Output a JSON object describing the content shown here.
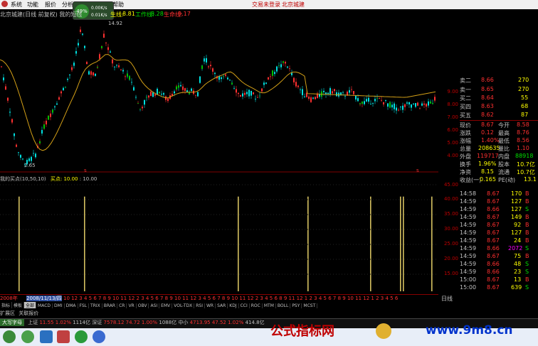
{
  "menu": {
    "items": [
      "系统",
      "功能",
      "报价",
      "分析",
      "帮助"
    ],
    "login_text": "交易未登录",
    "city_text": "北京城建"
  },
  "speed_widget": {
    "percent": "49%",
    "up": "0.00K/s",
    "down": "0.01K/s"
  },
  "chart_header": {
    "title": "北京城建(日线 前复权) 我的短线",
    "ma_prefix": "生线:",
    "ma_value": "8.81",
    "work_label": "工作线:",
    "work_value": "8.28",
    "life_label": "生命线:",
    "life_value": "9.17"
  },
  "price_chart": {
    "high_label": "14.92",
    "low_label": "2.65",
    "axis_labels": [
      "9.00",
      "8.00",
      "7.00",
      "6.00",
      "5.00",
      "4.00"
    ],
    "colors": {
      "up": "#ff3030",
      "down": "#00e0e0",
      "ma": "#d4a017",
      "buy_signal": "#00c000"
    }
  },
  "chart_data": {
    "type": "bar",
    "title": "我的买点(10,50,10)",
    "series": [
      {
        "name": "买点",
        "value_label": "10.00",
        "value2": "10.00"
      }
    ],
    "ylim": [
      0,
      45
    ],
    "y_ticks": [
      "45.00",
      "40.00",
      "35.00",
      "30.00",
      "25.00",
      "20.00",
      "15.00"
    ],
    "signal_values": [
      40,
      40,
      40,
      40,
      40,
      40,
      40,
      40
    ]
  },
  "indicator_header": {
    "name": "我的买点(10,50,10)",
    "label": "买点:",
    "value": "10.00",
    "value2": "10.00"
  },
  "quote": {
    "asks": [
      {
        "label": "卖二",
        "price": "8.66",
        "vol": "270"
      },
      {
        "label": "卖一",
        "price": "8.65",
        "vol": "270"
      },
      {
        "label": "买二",
        "price": "8.64",
        "vol": "55"
      },
      {
        "label": "买四",
        "price": "8.63",
        "vol": "68"
      },
      {
        "label": "买五",
        "price": "8.62",
        "vol": "87"
      }
    ],
    "stats": [
      {
        "l1": "现价",
        "v1": "8.67",
        "l2": "今开",
        "v2": "8.58"
      },
      {
        "l1": "涨跌",
        "v1": "0.12",
        "l2": "最高",
        "v2": "8.76"
      },
      {
        "l1": "涨幅",
        "v1": "1.40%",
        "l2": "最低",
        "v2": "8.56"
      },
      {
        "l1": "总量",
        "v1": "208635",
        "l2": "量比",
        "v2": "1.10"
      },
      {
        "l1": "外盘",
        "v1": "119717",
        "l2": "内盘",
        "v2": "88918"
      },
      {
        "l1": "换手",
        "v1": "1.96%",
        "l2": "股本",
        "v2": "10.7亿"
      },
      {
        "l1": "净资",
        "v1": "8.15",
        "l2": "流通",
        "v2": "10.7亿"
      },
      {
        "l1": "收益(一)",
        "v1": "0.165",
        "l2": "PE(动)",
        "v2": "13.1"
      }
    ]
  },
  "trades": [
    {
      "time": "14:58",
      "price": "8.67",
      "vol": "170",
      "side": "B"
    },
    {
      "time": "14:59",
      "price": "8.67",
      "vol": "127",
      "side": "B"
    },
    {
      "time": "14:59",
      "price": "8.66",
      "vol": "127",
      "side": "S"
    },
    {
      "time": "14:59",
      "price": "8.67",
      "vol": "149",
      "side": "B"
    },
    {
      "time": "14:59",
      "price": "8.67",
      "vol": "92",
      "side": "B"
    },
    {
      "time": "14:59",
      "price": "8.67",
      "vol": "127",
      "side": "B"
    },
    {
      "time": "14:59",
      "price": "8.67",
      "vol": "24",
      "side": "B"
    },
    {
      "time": "14:59",
      "price": "8.66",
      "vol": "2072",
      "side": "S"
    },
    {
      "time": "14:59",
      "price": "8.67",
      "vol": "75",
      "side": "B"
    },
    {
      "time": "14:59",
      "price": "8.66",
      "vol": "48",
      "side": "S"
    },
    {
      "time": "14:59",
      "price": "8.66",
      "vol": "23",
      "side": "S"
    },
    {
      "time": "15:00",
      "price": "8.67",
      "vol": "13",
      "side": "B"
    },
    {
      "time": "15:00",
      "price": "8.67",
      "vol": "639",
      "side": "S"
    }
  ],
  "date_axis": {
    "start": "2008年",
    "highlight": "2008/11/13/四",
    "ticks": [
      "10",
      "12",
      "3",
      "4",
      "5",
      "6",
      "7",
      "8",
      "9",
      "10",
      "11",
      "12",
      "2",
      "3",
      "4",
      "5",
      "6",
      "7",
      "8",
      "9",
      "10",
      "11",
      "12",
      "3",
      "4",
      "5",
      "6",
      "7",
      "8",
      "9",
      "10",
      "11",
      "12",
      "2",
      "3",
      "4",
      "5",
      "6",
      "8",
      "9",
      "11",
      "12",
      "1",
      "2",
      "3",
      "4",
      "5",
      "6",
      "7",
      "8",
      "9",
      "10",
      "11",
      "12",
      "1",
      "2",
      "3",
      "4",
      "5",
      "6"
    ]
  },
  "right_period": "日线",
  "tabs": [
    "指标",
    "模板",
    "全部",
    "MACD",
    "DMI",
    "DMA",
    "FSL",
    "TRIX",
    "BRAR",
    "CR",
    "VR",
    "OBV",
    "ASI",
    "EMV",
    "VOL-TDX",
    "RSI",
    "WR",
    "SAR",
    "KDJ",
    "CCI",
    "ROC",
    "MTM",
    "BOLL",
    "PSY",
    "MCST"
  ],
  "expand_labels": [
    "扩展区",
    "关联报价"
  ],
  "status": {
    "items": [
      {
        "t": "上证",
        "c": "#c0c0c0"
      },
      {
        "t": "11.55",
        "c": "#ff3030"
      },
      {
        "t": "1.02%",
        "c": "#ff3030"
      },
      {
        "t": "1114亿",
        "c": "#c0c0c0"
      },
      {
        "t": "深证",
        "c": "#c0c0c0"
      },
      {
        "t": "7578.12",
        "c": "#ff3030"
      },
      {
        "t": "74.72",
        "c": "#ff3030"
      },
      {
        "t": "1.00%",
        "c": "#ff3030"
      },
      {
        "t": "1088亿",
        "c": "#c0c0c0"
      },
      {
        "t": "中小",
        "c": "#c0c0c0"
      },
      {
        "t": "4713.95",
        "c": "#ff3030"
      },
      {
        "t": "47.52",
        "c": "#ff3030"
      },
      {
        "t": "1.02%",
        "c": "#ff3030"
      },
      {
        "t": "414.8亿",
        "c": "#c0c0c0"
      }
    ],
    "left_tab": "大写字母"
  },
  "ad": {
    "left": "公式指标网",
    "right": "www.9m8.cn"
  }
}
